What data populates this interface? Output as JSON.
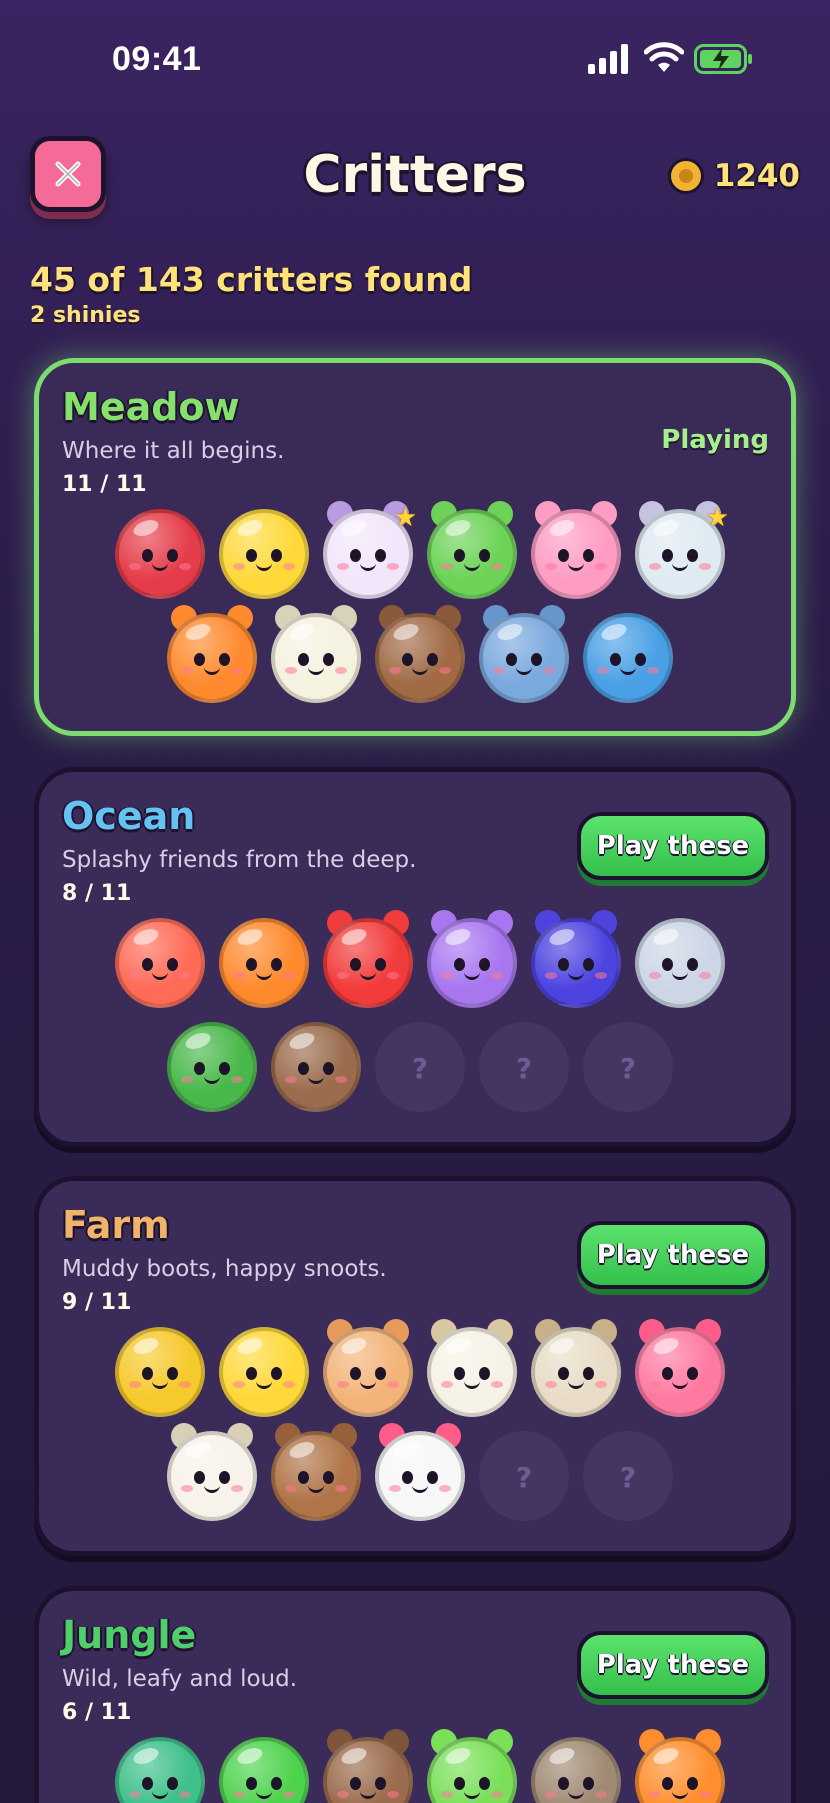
{
  "status": {
    "time": "09:41"
  },
  "header": {
    "title": "Critters",
    "coins": "1240"
  },
  "summary": {
    "found": "45 of 143 critters found",
    "shinies": "2 shinies"
  },
  "colors": {
    "accent_green": "#7ddc6f",
    "gold": "#ffe27a",
    "close_pink": "#f56b97"
  },
  "worlds": [
    {
      "id": "meadow",
      "title": "Meadow",
      "title_color": "#86e06c",
      "desc": "Where it all begins.",
      "count": "11 / 11",
      "status": "Playing",
      "rows": [
        [
          {
            "name": "ladybug",
            "color": "#e43c48",
            "ears": ""
          },
          {
            "name": "chick",
            "color": "#ffd93a",
            "ears": ""
          },
          {
            "name": "shiny-hamster",
            "color": "#f2e6fb",
            "ears": "#b99be0",
            "shiny": true
          },
          {
            "name": "frog",
            "color": "#6cd357",
            "ears": "#6cd357"
          },
          {
            "name": "bunny",
            "color": "#ff9cc4",
            "ears": "#ff9cc4"
          },
          {
            "name": "shiny-cat",
            "color": "#dfeaf2",
            "ears": "#c7c2df",
            "shiny": true
          }
        ],
        [
          {
            "name": "fox",
            "color": "#ff8a2e",
            "ears": "#ff8a2e"
          },
          {
            "name": "sheep",
            "color": "#f6f2e0",
            "ears": "#d8d2b8"
          },
          {
            "name": "bear",
            "color": "#a06a45",
            "ears": "#8b5a3a"
          },
          {
            "name": "elephant",
            "color": "#7aa9de",
            "ears": "#6696cc"
          },
          {
            "name": "whale",
            "color": "#4aa0e6",
            "ears": ""
          }
        ]
      ]
    },
    {
      "id": "ocean",
      "title": "Ocean",
      "title_color": "#64c3f2",
      "desc": "Splashy friends from the deep.",
      "count": "8 / 11",
      "button": "Play these",
      "rows": [
        [
          {
            "name": "crab",
            "color": "#ff6b57",
            "ears": ""
          },
          {
            "name": "clownfish",
            "color": "#ff8a2e",
            "ears": ""
          },
          {
            "name": "octopus",
            "color": "#f23b3b",
            "ears": "#f23b3b"
          },
          {
            "name": "puffer",
            "color": "#a877f0",
            "ears": "#a877f0"
          },
          {
            "name": "sea-slug",
            "color": "#4d44e0",
            "ears": "#4d44e0"
          },
          {
            "name": "seal",
            "color": "#cdd6e6",
            "ears": ""
          }
        ],
        [
          {
            "name": "turtle",
            "color": "#49b84a",
            "ears": ""
          },
          {
            "name": "walrus",
            "color": "#9a6b4c",
            "ears": ""
          },
          {
            "name": "unknown-1",
            "unknown": true,
            "q": "?"
          },
          {
            "name": "unknown-2",
            "unknown": true,
            "q": "?"
          },
          {
            "name": "unknown-3",
            "unknown": true,
            "q": "?"
          }
        ]
      ]
    },
    {
      "id": "farm",
      "title": "Farm",
      "title_color": "#f0b36a",
      "desc": "Muddy boots, happy snoots.",
      "count": "9 / 11",
      "button": "Play these",
      "rows": [
        [
          {
            "name": "bee",
            "color": "#f6c92c",
            "ears": ""
          },
          {
            "name": "chick",
            "color": "#ffd93a",
            "ears": ""
          },
          {
            "name": "hamster",
            "color": "#f3b47a",
            "ears": "#e89a5a"
          },
          {
            "name": "sheep",
            "color": "#f6f2e6",
            "ears": "#d8c7a0"
          },
          {
            "name": "goat",
            "color": "#e8dcc6",
            "ears": "#c7b08a"
          },
          {
            "name": "pig",
            "color": "#ff7aa2",
            "ears": "#ff5c8a"
          }
        ],
        [
          {
            "name": "polar-bear",
            "color": "#f7f3ea",
            "ears": "#d9cfb4"
          },
          {
            "name": "cow-brown",
            "color": "#b07448",
            "ears": "#96603a"
          },
          {
            "name": "cow",
            "color": "#f7f7f7",
            "ears": "#ff5c8a"
          },
          {
            "name": "unknown-1",
            "unknown": true,
            "q": "?"
          },
          {
            "name": "unknown-2",
            "unknown": true,
            "q": "?"
          }
        ]
      ]
    },
    {
      "id": "jungle",
      "title": "Jungle",
      "title_color": "#4fcf6b",
      "desc": "Wild, leafy and loud.",
      "count": "6 / 11",
      "button": "Play these",
      "rows": [
        [
          {
            "name": "turtle",
            "color": "#3ec08a",
            "ears": ""
          },
          {
            "name": "lizard",
            "color": "#4ed34e",
            "ears": ""
          },
          {
            "name": "monkey",
            "color": "#9a6b4c",
            "ears": "#7f5539"
          },
          {
            "name": "frog",
            "color": "#7ae05a",
            "ears": "#7ae05a"
          },
          {
            "name": "sloth",
            "color": "#a08a74",
            "ears": ""
          },
          {
            "name": "tiger",
            "color": "#ff8f2e",
            "ears": "#ff8f2e"
          }
        ]
      ]
    }
  ]
}
